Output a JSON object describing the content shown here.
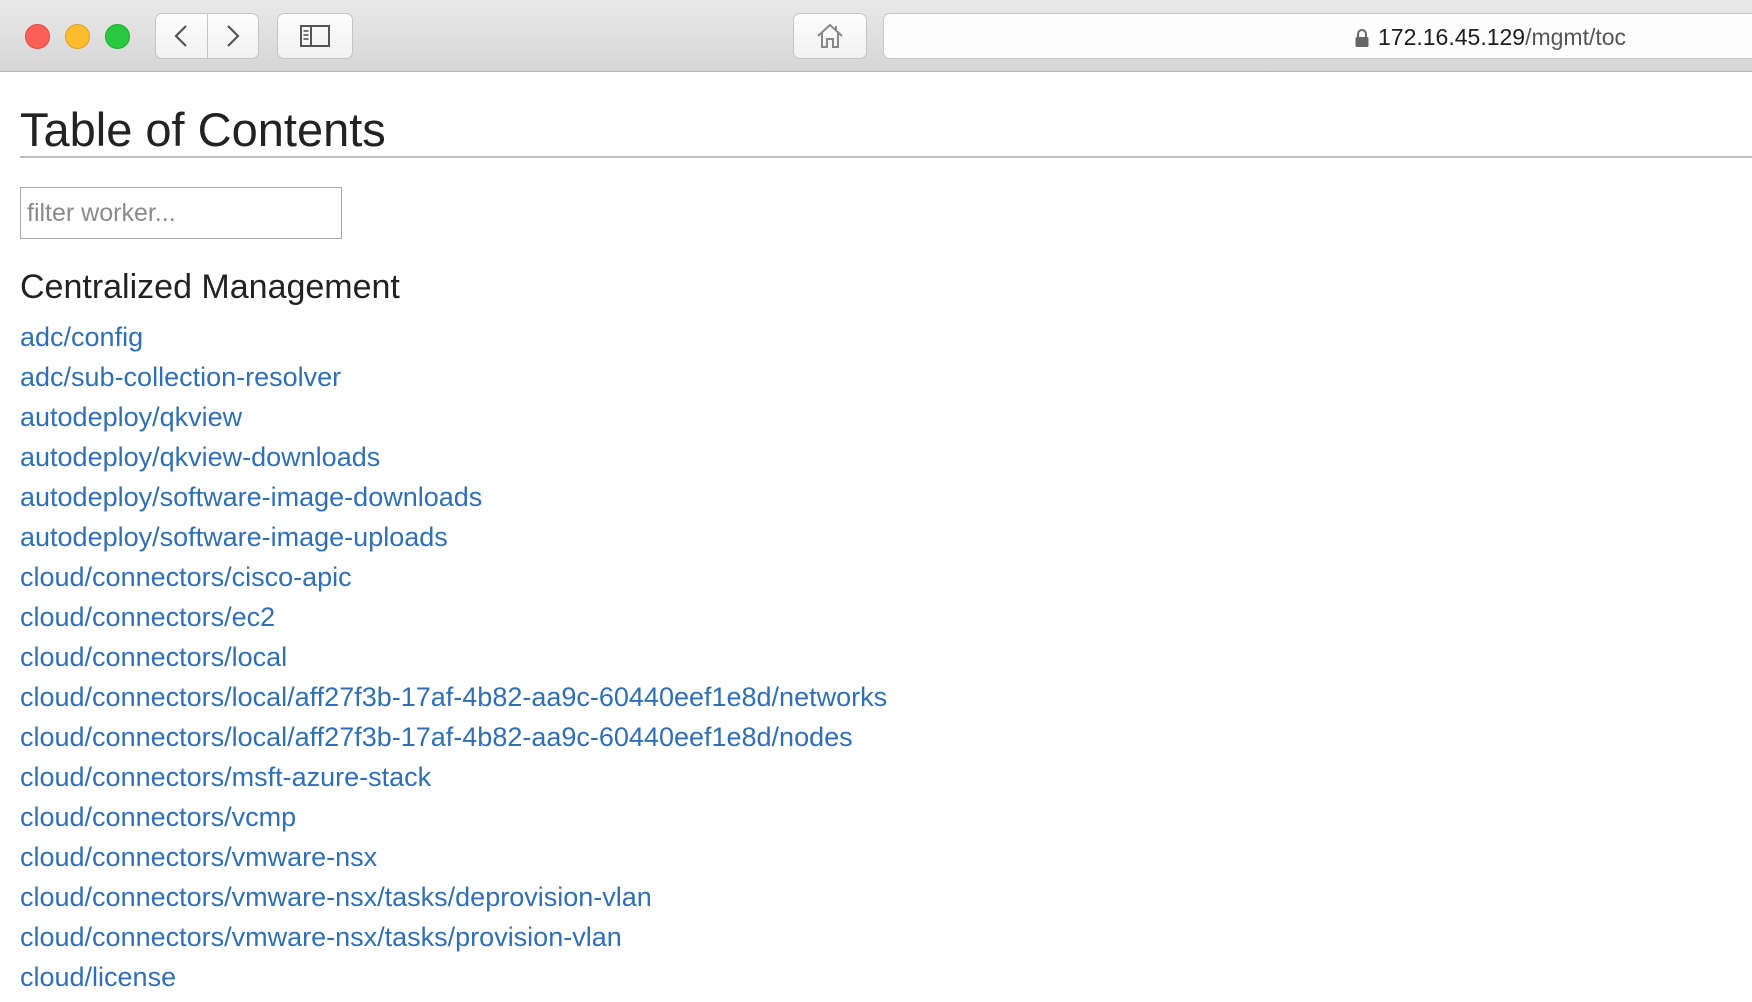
{
  "browser": {
    "address": {
      "host": "172.16.45.129",
      "path": "/mgmt/toc"
    },
    "icons": {
      "back": "chevron-left-icon",
      "forward": "chevron-right-icon",
      "sidebar": "sidebar-icon",
      "home": "home-icon",
      "lock": "lock-icon"
    }
  },
  "page": {
    "title": "Table of Contents",
    "filter": {
      "placeholder": "filter worker...",
      "value": ""
    },
    "section": {
      "heading": "Centralized Management",
      "links": [
        "adc/config",
        "adc/sub-collection-resolver",
        "autodeploy/qkview",
        "autodeploy/qkview-downloads",
        "autodeploy/software-image-downloads",
        "autodeploy/software-image-uploads",
        "cloud/connectors/cisco-apic",
        "cloud/connectors/ec2",
        "cloud/connectors/local",
        "cloud/connectors/local/aff27f3b-17af-4b82-aa9c-60440eef1e8d/networks",
        "cloud/connectors/local/aff27f3b-17af-4b82-aa9c-60440eef1e8d/nodes",
        "cloud/connectors/msft-azure-stack",
        "cloud/connectors/vcmp",
        "cloud/connectors/vmware-nsx",
        "cloud/connectors/vmware-nsx/tasks/deprovision-vlan",
        "cloud/connectors/vmware-nsx/tasks/provision-vlan",
        "cloud/license"
      ]
    }
  },
  "colors": {
    "link": "#2f6fb7",
    "heading": "#222222",
    "close": "#fc5f57",
    "minimize": "#fdbc2e",
    "maximize": "#28c840"
  }
}
